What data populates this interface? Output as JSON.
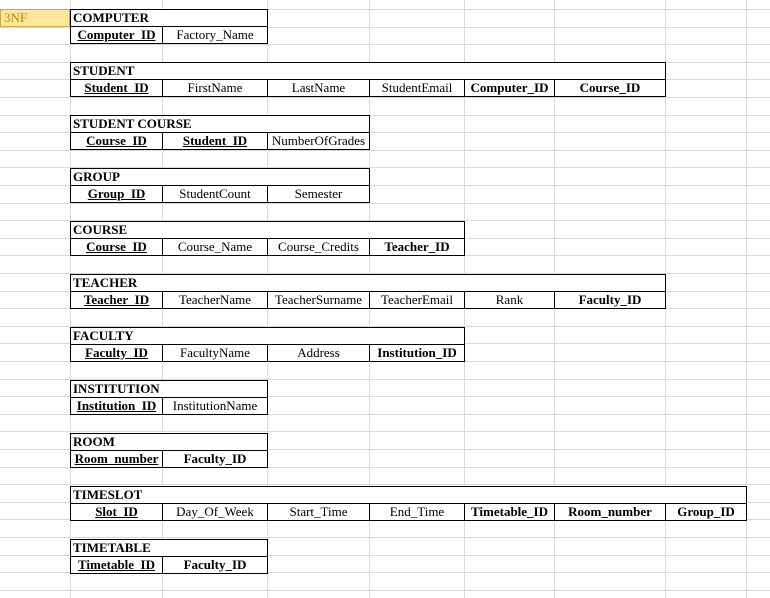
{
  "sheet_label": "3NF",
  "tables": [
    {
      "name": "COMPUTER",
      "columns": [
        {
          "label": "Computer_ID",
          "style": "key"
        },
        {
          "label": "Factory_Name",
          "style": "plain"
        }
      ]
    },
    {
      "name": "STUDENT",
      "columns": [
        {
          "label": "Student_ID",
          "style": "key"
        },
        {
          "label": "FirstName",
          "style": "plain"
        },
        {
          "label": "LastName",
          "style": "plain"
        },
        {
          "label": "StudentEmail",
          "style": "plain"
        },
        {
          "label": "Computer_ID",
          "style": "fk"
        },
        {
          "label": "Course_ID",
          "style": "fk"
        }
      ]
    },
    {
      "name": "STUDENT COURSE",
      "columns": [
        {
          "label": "Course_ID",
          "style": "key"
        },
        {
          "label": "Student_ID",
          "style": "key"
        },
        {
          "label": "NumberOfGrades",
          "style": "plain"
        }
      ]
    },
    {
      "name": "GROUP",
      "columns": [
        {
          "label": "Group_ID",
          "style": "key"
        },
        {
          "label": "StudentCount",
          "style": "plain"
        },
        {
          "label": "Semester",
          "style": "plain"
        }
      ]
    },
    {
      "name": "COURSE",
      "columns": [
        {
          "label": "Course_ID",
          "style": "key"
        },
        {
          "label": "Course_Name",
          "style": "plain"
        },
        {
          "label": "Course_Credits",
          "style": "plain"
        },
        {
          "label": "Teacher_ID",
          "style": "fk"
        }
      ]
    },
    {
      "name": "TEACHER",
      "columns": [
        {
          "label": "Teacher_ID",
          "style": "key"
        },
        {
          "label": "TeacherName",
          "style": "plain"
        },
        {
          "label": "TeacherSurname",
          "style": "plain"
        },
        {
          "label": "TeacherEmail",
          "style": "plain"
        },
        {
          "label": "Rank",
          "style": "plain"
        },
        {
          "label": "Faculty_ID",
          "style": "fk"
        }
      ]
    },
    {
      "name": "FACULTY",
      "columns": [
        {
          "label": "Faculty_ID",
          "style": "key"
        },
        {
          "label": "FacultyName",
          "style": "plain"
        },
        {
          "label": "Address",
          "style": "plain"
        },
        {
          "label": "Institution_ID",
          "style": "fk"
        }
      ]
    },
    {
      "name": "INSTITUTION",
      "columns": [
        {
          "label": "Institution_ID",
          "style": "key"
        },
        {
          "label": "InstitutionName",
          "style": "plain"
        }
      ]
    },
    {
      "name": "ROOM",
      "columns": [
        {
          "label": "Room_number",
          "style": "key"
        },
        {
          "label": "Faculty_ID",
          "style": "fk"
        }
      ]
    },
    {
      "name": "TIMESLOT",
      "columns": [
        {
          "label": "Slot_ID",
          "style": "key"
        },
        {
          "label": "Day_Of_Week",
          "style": "plain"
        },
        {
          "label": "Start_Time",
          "style": "plain"
        },
        {
          "label": "End_Time",
          "style": "plain"
        },
        {
          "label": "Timetable_ID",
          "style": "fk"
        },
        {
          "label": "Room_number",
          "style": "fk"
        },
        {
          "label": "Group_ID",
          "style": "fk"
        }
      ]
    },
    {
      "name": "TIMETABLE",
      "columns": [
        {
          "label": "Timetable_ID",
          "style": "key"
        },
        {
          "label": "Faculty_ID",
          "style": "fk"
        }
      ]
    }
  ]
}
